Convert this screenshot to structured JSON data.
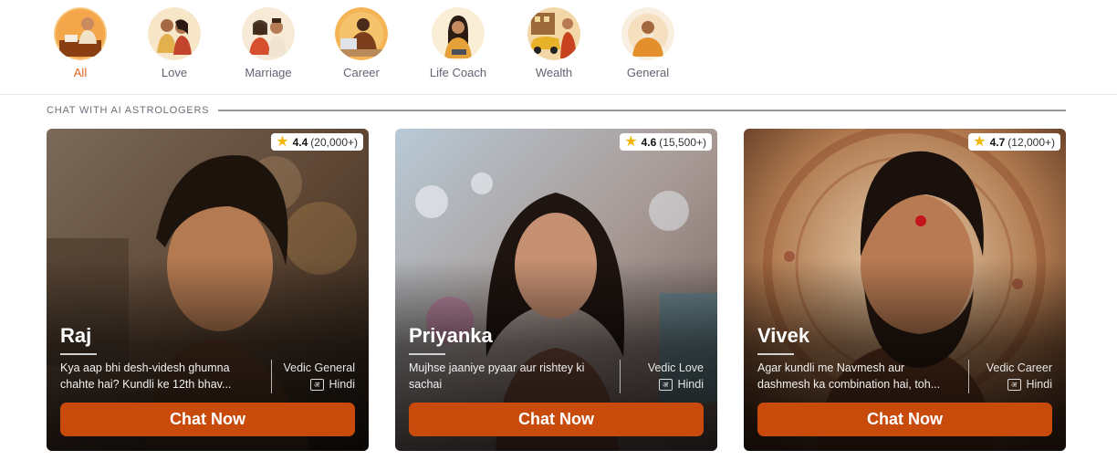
{
  "categories": [
    {
      "label": "All",
      "active": true,
      "icon": "astrologer-at-desk-image"
    },
    {
      "label": "Love",
      "active": false,
      "icon": "couple-image"
    },
    {
      "label": "Marriage",
      "active": false,
      "icon": "wedding-couple-image"
    },
    {
      "label": "Career",
      "active": false,
      "icon": "man-at-laptop-image"
    },
    {
      "label": "Life Coach",
      "active": false,
      "icon": "thinking-woman-image"
    },
    {
      "label": "Wealth",
      "active": false,
      "icon": "woman-with-car-image"
    },
    {
      "label": "General",
      "active": false,
      "icon": "sage-image"
    }
  ],
  "section_title": "CHAT WITH AI ASTROLOGERS",
  "astrologers": [
    {
      "name": "Raj",
      "rating": "4.4",
      "reviews": "(20,000+)",
      "description": "Kya aap bhi desh-videsh ghumna chahte hai? Kundli ke 12th bhav...",
      "specialty": "Vedic General",
      "language": "Hindi",
      "button": "Chat Now"
    },
    {
      "name": "Priyanka",
      "rating": "4.6",
      "reviews": "(15,500+)",
      "description": "Mujhse jaaniye pyaar aur rishtey ki sachai",
      "specialty": "Vedic Love",
      "language": "Hindi",
      "button": "Chat Now"
    },
    {
      "name": "Vivek",
      "rating": "4.7",
      "reviews": "(12,000+)",
      "description": "Agar kundli me Navmesh aur dashmesh ka combination hai, toh...",
      "specialty": "Vedic Career",
      "language": "Hindi",
      "button": "Chat Now"
    }
  ],
  "language_icon_glyph": "अ",
  "colors": {
    "accent": "#e0641e",
    "button": "#c94b0c",
    "star": "#f2b705"
  }
}
